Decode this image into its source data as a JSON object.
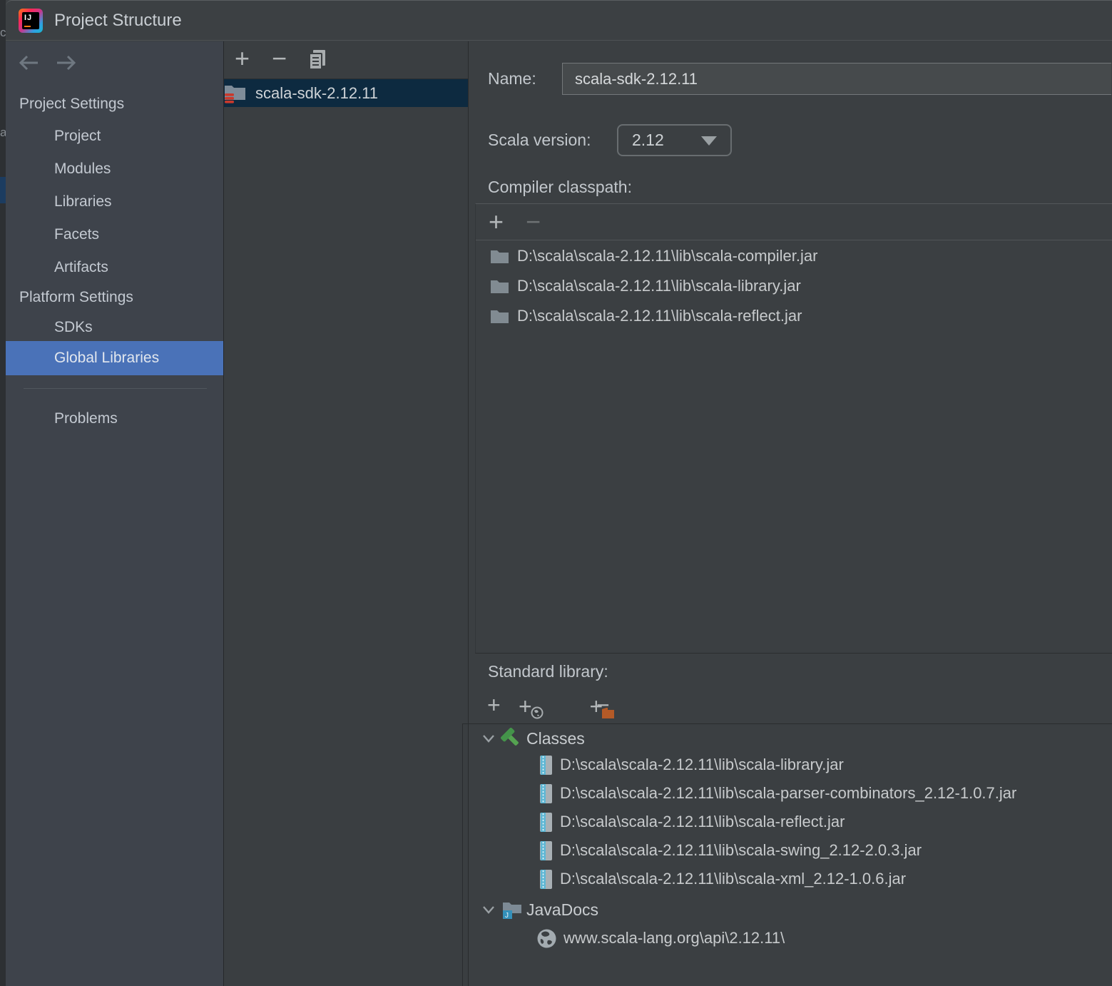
{
  "window": {
    "title": "Project Structure"
  },
  "sidebar": {
    "sections": [
      {
        "label": "Project Settings",
        "items": [
          "Project",
          "Modules",
          "Libraries",
          "Facets",
          "Artifacts"
        ]
      },
      {
        "label": "Platform Settings",
        "items": [
          "SDKs",
          "Global Libraries"
        ]
      }
    ],
    "problems_label": "Problems",
    "selected_item": "Global Libraries"
  },
  "library_list": {
    "items": [
      {
        "name": "scala-sdk-2.12.11"
      }
    ],
    "selected": "scala-sdk-2.12.11"
  },
  "details": {
    "name_label": "Name:",
    "name_value": "scala-sdk-2.12.11",
    "scala_version_label": "Scala version:",
    "scala_version_value": "2.12",
    "compiler_classpath_label": "Compiler classpath:",
    "compiler_classpath": [
      "D:\\scala\\scala-2.12.11\\lib\\scala-compiler.jar",
      "D:\\scala\\scala-2.12.11\\lib\\scala-library.jar",
      "D:\\scala\\scala-2.12.11\\lib\\scala-reflect.jar"
    ],
    "standard_library_label": "Standard library:",
    "tree": {
      "classes_label": "Classes",
      "classes_jars": [
        "D:\\scala\\scala-2.12.11\\lib\\scala-library.jar",
        "D:\\scala\\scala-2.12.11\\lib\\scala-parser-combinators_2.12-1.0.7.jar",
        "D:\\scala\\scala-2.12.11\\lib\\scala-reflect.jar",
        "D:\\scala\\scala-2.12.11\\lib\\scala-swing_2.12-2.0.3.jar",
        "D:\\scala\\scala-2.12.11\\lib\\scala-xml_2.12-1.0.6.jar"
      ],
      "javadocs_label": "JavaDocs",
      "javadocs_url": "www.scala-lang.org\\api\\2.12.11\\"
    }
  },
  "colors": {
    "sidebar_selection": "#4a72b8",
    "list_selection": "#0d2a40",
    "scala_red": "#c9392c",
    "classes_green": "#4f9d4b",
    "add_doc_orange": "#b45a27",
    "javadocs_blue": "#3390ba"
  },
  "background_fragments": {
    "frag1": "c",
    "frag2": "a"
  }
}
